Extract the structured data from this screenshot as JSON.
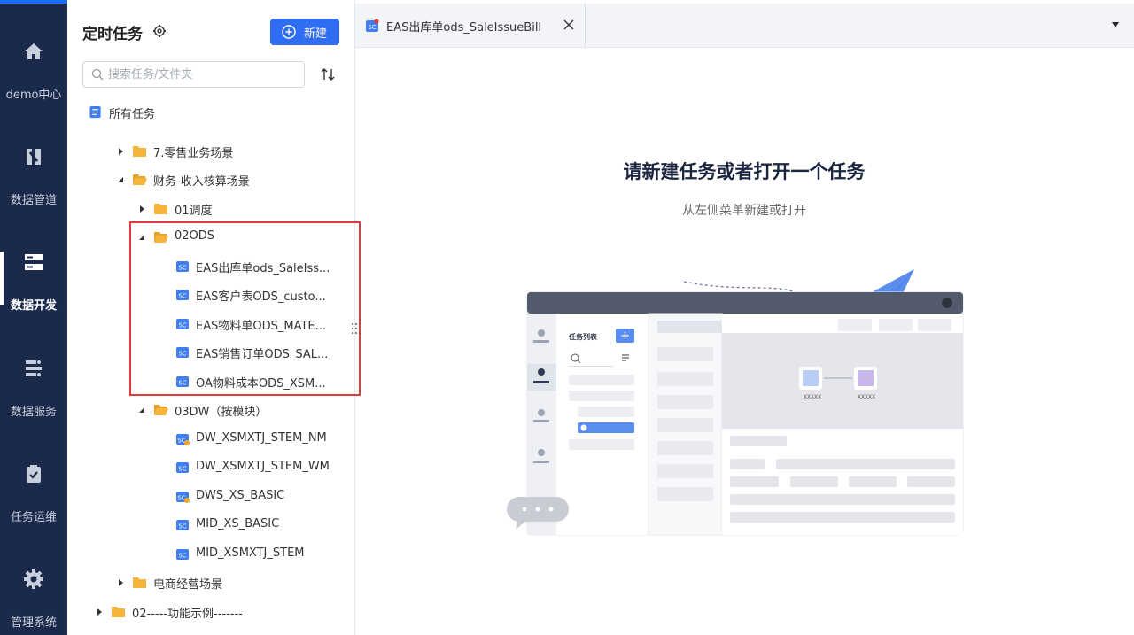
{
  "nav": {
    "items": [
      {
        "label": "demo中心",
        "icon": "home-icon"
      },
      {
        "label": "数据管道",
        "icon": "pipeline-icon"
      },
      {
        "label": "数据开发",
        "icon": "dev-icon"
      },
      {
        "label": "数据服务",
        "icon": "service-icon"
      },
      {
        "label": "任务运维",
        "icon": "clipboard-check-icon"
      },
      {
        "label": "管理系统",
        "icon": "gear-icon"
      }
    ],
    "active": "数据开发"
  },
  "panel": {
    "title": "定时任务",
    "new_label": "新建",
    "search_placeholder": "搜索任务/文件夹"
  },
  "tree": {
    "root": "所有任务",
    "items": [
      {
        "label": "7.零售业务场景",
        "type": "folder",
        "state": "collapsed"
      },
      {
        "label": "财务-收入核算场景",
        "type": "folder",
        "state": "expanded"
      },
      {
        "label": "01调度",
        "type": "folder",
        "state": "collapsed"
      },
      {
        "label": "02ODS",
        "type": "folder",
        "state": "expanded"
      },
      {
        "label": "EAS出库单ods_SaleIss...",
        "type": "task"
      },
      {
        "label": "EAS客户表ODS_custo...",
        "type": "task"
      },
      {
        "label": "EAS物料单ODS_MATE...",
        "type": "task"
      },
      {
        "label": "EAS销售订单ODS_SAL...",
        "type": "task"
      },
      {
        "label": "OA物料成本ODS_XSM...",
        "type": "task"
      },
      {
        "label": "03DW（按模块）",
        "type": "folder",
        "state": "expanded"
      },
      {
        "label": "DW_XSMXTJ_STEM_NM",
        "type": "task-warn"
      },
      {
        "label": "DW_XSMXTJ_STEM_WM",
        "type": "task"
      },
      {
        "label": "DWS_XS_BASIC",
        "type": "task-warn"
      },
      {
        "label": "MID_XS_BASIC",
        "type": "task"
      },
      {
        "label": "MID_XSMXTJ_STEM",
        "type": "task"
      },
      {
        "label": "电商经营场景",
        "type": "folder",
        "state": "collapsed"
      },
      {
        "label": "02-----功能示例-------",
        "type": "folder",
        "state": "collapsed"
      }
    ]
  },
  "tabs": [
    {
      "label": "EAS出库单ods_SaleIssueBill"
    }
  ],
  "empty_state": {
    "title": "请新建任务或者打开一个任务",
    "subtitle": "从左侧菜单新建或打开"
  },
  "illustration": {
    "list_title": "任务列表",
    "node_label_a": "XXXXX",
    "node_label_b": "XXXXX"
  },
  "colors": {
    "nav_bg": "#1b2a4a",
    "accent": "#2f6ef3",
    "folder": "#f5b43a",
    "highlight": "#e03b3b"
  }
}
